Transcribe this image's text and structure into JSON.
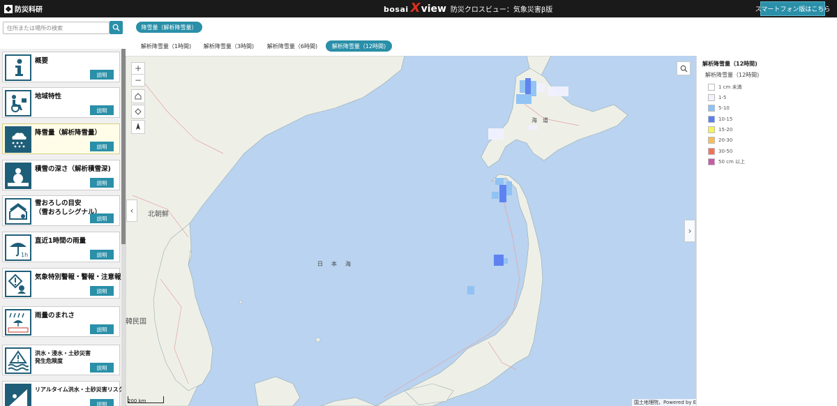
{
  "header": {
    "org_name": "防災科研",
    "brand_bosai": "bosai",
    "brand_x": "X",
    "brand_view": "view",
    "brand_subtitle": "防災クロスビュー：気象災害β版",
    "smartphone_button": "スマートフォン版はこちら"
  },
  "search": {
    "placeholder": "住所または場所の検索"
  },
  "category_pill": "降雪量（解析降雪量）",
  "tabs": [
    {
      "label": "解析降雪量（1時間)",
      "active": false
    },
    {
      "label": "解析降雪量（3時間)",
      "active": false
    },
    {
      "label": "解析降雪量（6時間)",
      "active": false
    },
    {
      "label": "解析降雪量（12時間)",
      "active": true
    }
  ],
  "sidebar": {
    "items": [
      {
        "label": "概要",
        "button": "説明",
        "icon": "info-icon"
      },
      {
        "label": "地域特性",
        "button": "説明",
        "icon": "wheelchair-icon"
      },
      {
        "label": "降雪量（解析降雪量）",
        "button": "説明",
        "icon": "snowfall-icon",
        "active": true
      },
      {
        "label": "積雪の深さ（解析積雪深)",
        "button": "説明",
        "icon": "snowman-icon"
      },
      {
        "label": "雪おろしの目安",
        "label2": "（雪おろしシグナル）",
        "button": "説明",
        "icon": "roof-snow-icon"
      },
      {
        "label": "直近1時間の雨量",
        "button": "説明",
        "icon": "umbrella-icon"
      },
      {
        "label": "気象特別警報・警報・注意報",
        "button": "説明",
        "icon": "warning-icon"
      },
      {
        "label": "雨量のまれさ",
        "button": "説明",
        "icon": "rain-rarity-icon"
      },
      {
        "label": "洪水・浸水・土砂災害",
        "label2": "発生危険度",
        "button": "説明",
        "icon": "flood-icon"
      },
      {
        "label": "リアルタイム洪水・土砂災害リスク",
        "button": "説明",
        "icon": "landslide-icon"
      }
    ]
  },
  "map": {
    "labels": {
      "korea_north": "北朝鮮",
      "korea_south": "韓民国",
      "sea_of_japan": "日　本　海",
      "hokkaido": "海　道"
    },
    "scale": "200 km",
    "attribution": "国土地理院，Powered by Esri"
  },
  "legend": {
    "title": "解析降雪量（12時間)",
    "subtitle": "解析降雪量（12時間)",
    "items": [
      {
        "label": "1 cm 未満",
        "color": "#ffffff"
      },
      {
        "label": "1-5",
        "color": "#f2f2ff"
      },
      {
        "label": "5-10",
        "color": "#8ec2f5"
      },
      {
        "label": "10-15",
        "color": "#5a7ff0"
      },
      {
        "label": "15-20",
        "color": "#f7f35a"
      },
      {
        "label": "20-30",
        "color": "#f7be5a"
      },
      {
        "label": "30-50",
        "color": "#f2735a"
      },
      {
        "label": "50 cm 以上",
        "color": "#c95aa8"
      }
    ]
  }
}
